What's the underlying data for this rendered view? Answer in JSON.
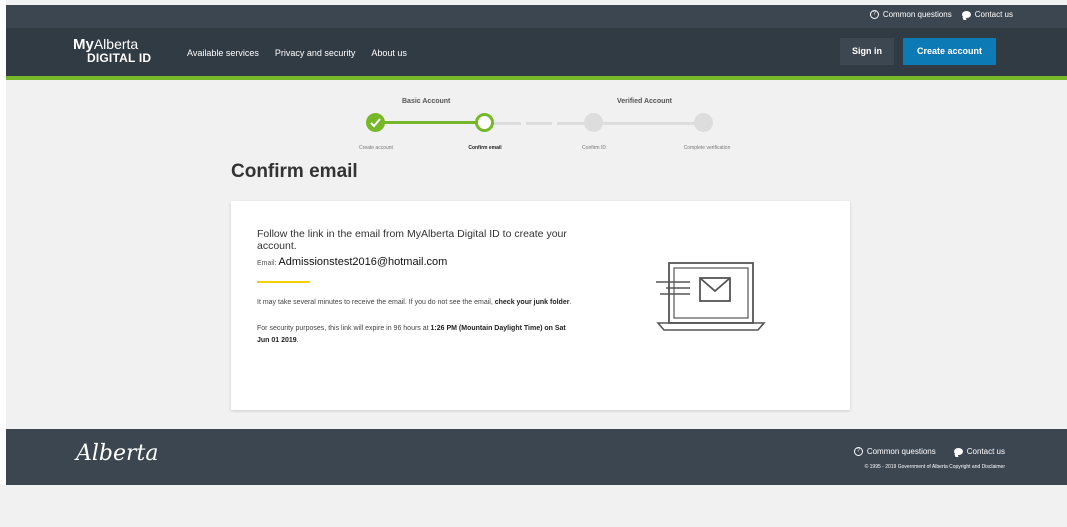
{
  "utility": {
    "common_questions": "Common questions",
    "contact_us": "Contact us"
  },
  "header": {
    "logo_my": "My",
    "logo_alberta": "Alberta",
    "logo_digital_id": "DIGITAL ID",
    "nav": [
      "Available services",
      "Privacy and security",
      "About us"
    ],
    "sign_in": "Sign in",
    "create_account": "Create account"
  },
  "stepper": {
    "group_basic": "Basic Account",
    "group_verified": "Verified Account",
    "steps": [
      "Create account",
      "Confirm email",
      "Confirm ID",
      "Complete verification"
    ],
    "current_step": 2,
    "colors": {
      "done": "#77b82a",
      "pending": "#dddddd"
    }
  },
  "page": {
    "title": "Confirm email"
  },
  "card": {
    "lead": "Follow the link in the email from MyAlberta Digital ID to create your account.",
    "email_label": "Email:",
    "email_value": "Admissionstest2016@hotmail.com",
    "note1_prefix": "It may take several minutes to receive the email. If you do not see the email,",
    "note1_bold": "check your junk folder",
    "note1_suffix": ".",
    "note2_prefix": "For security purposes, this link will expire in 96 hours at",
    "note2_bold": "1:26 PM (Mountain Daylight Time) on Sat Jun 01 2019",
    "note2_suffix": ".",
    "illustration": "laptop-email-icon"
  },
  "footer": {
    "logo": "Alberta",
    "common_questions": "Common questions",
    "contact_us": "Contact us",
    "copyright": "© 1995 - 2019 Government of Alberta Copyright and Disclaimer"
  }
}
